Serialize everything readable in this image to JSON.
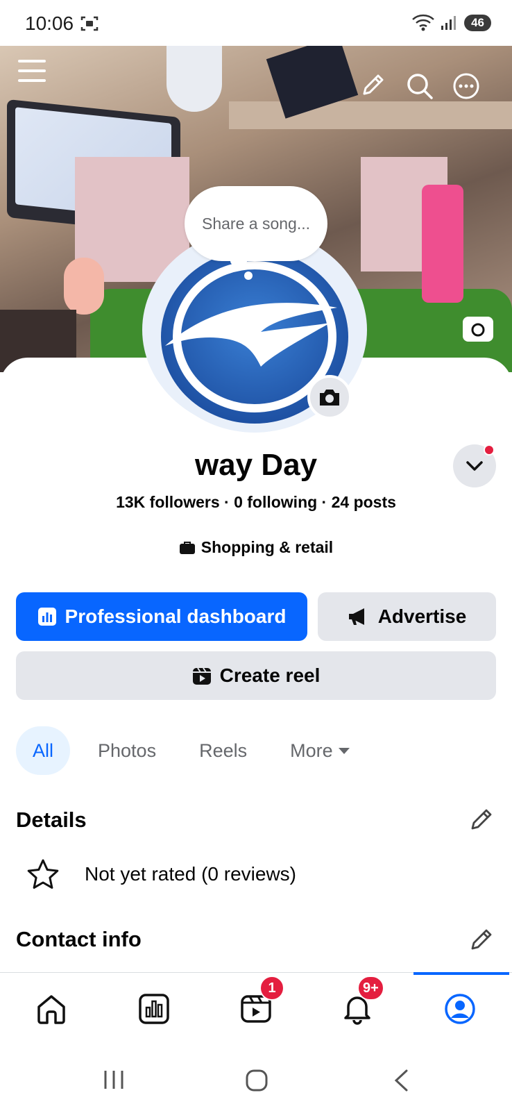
{
  "status_bar": {
    "time": "10:06",
    "battery": "46"
  },
  "cover": {
    "share_song": "Share a song..."
  },
  "profile": {
    "name": "way Day",
    "stats": "13K followers · 0 following · 24 posts",
    "category": "Shopping & retail"
  },
  "buttons": {
    "dashboard": "Professional dashboard",
    "advertise": "Advertise",
    "create_reel": "Create reel"
  },
  "filters": [
    "All",
    "Photos",
    "Reels",
    "More"
  ],
  "details": {
    "title": "Details",
    "rating": "Not yet rated (0 reviews)"
  },
  "contact": {
    "title": "Contact info"
  },
  "bottom_nav": {
    "reels_badge": "1",
    "notifications_badge": "9+",
    "active": "profile"
  },
  "colors": {
    "accent": "#0866ff",
    "badge": "#e41e3f",
    "surface": "#e4e6eb"
  }
}
